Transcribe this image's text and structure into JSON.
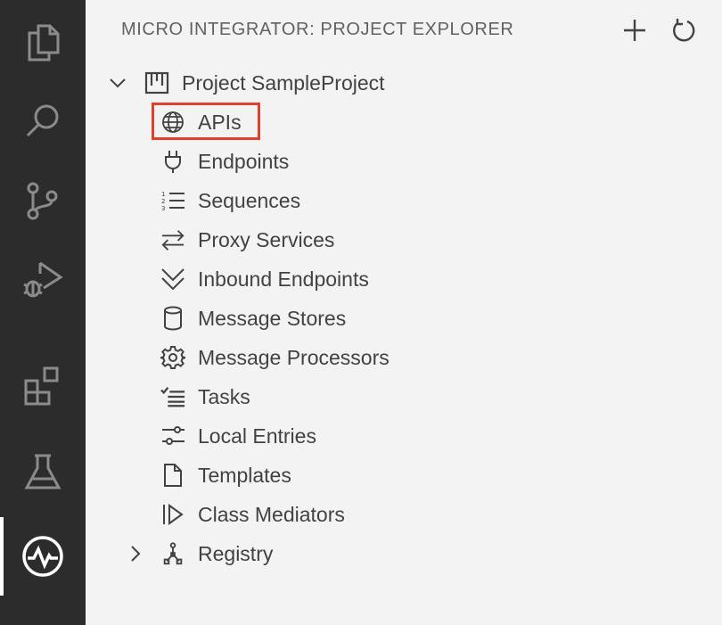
{
  "activity_bar": {
    "items": [
      {
        "icon": "explorer-files-icon"
      },
      {
        "icon": "search-icon"
      },
      {
        "icon": "source-control-icon"
      },
      {
        "icon": "run-debug-icon"
      },
      {
        "icon": "extensions-icon"
      },
      {
        "icon": "testing-flask-icon"
      },
      {
        "icon": "micro-integrator-icon",
        "active": true
      }
    ]
  },
  "panel": {
    "title": "MICRO INTEGRATOR: PROJECT EXPLORER",
    "actions": [
      {
        "icon": "add-icon"
      },
      {
        "icon": "refresh-icon"
      }
    ]
  },
  "tree": {
    "project": {
      "label": "Project SampleProject",
      "expanded": true,
      "icon": "project-icon"
    },
    "items": [
      {
        "label": "APIs",
        "icon": "globe-icon",
        "highlighted": true
      },
      {
        "label": "Endpoints",
        "icon": "plug-icon"
      },
      {
        "label": "Sequences",
        "icon": "numbered-list-icon"
      },
      {
        "label": "Proxy Services",
        "icon": "arrows-swap-icon"
      },
      {
        "label": "Inbound Endpoints",
        "icon": "double-chevron-down-icon"
      },
      {
        "label": "Message Stores",
        "icon": "database-icon"
      },
      {
        "label": "Message Processors",
        "icon": "gear-icon"
      },
      {
        "label": "Tasks",
        "icon": "checklist-icon"
      },
      {
        "label": "Local Entries",
        "icon": "sliders-icon"
      },
      {
        "label": "Templates",
        "icon": "file-icon"
      },
      {
        "label": "Class Mediators",
        "icon": "class-mediator-icon"
      }
    ],
    "registry": {
      "label": "Registry",
      "expanded": false,
      "icon": "type-hierarchy-icon"
    }
  },
  "colors": {
    "activity_bar_bg": "#2c2c2c",
    "activity_icon": "#8b8b8b",
    "active_icon": "#ffffff",
    "panel_bg": "#f3f3f3",
    "text": "#424242",
    "highlight_border": "#e0412b"
  }
}
